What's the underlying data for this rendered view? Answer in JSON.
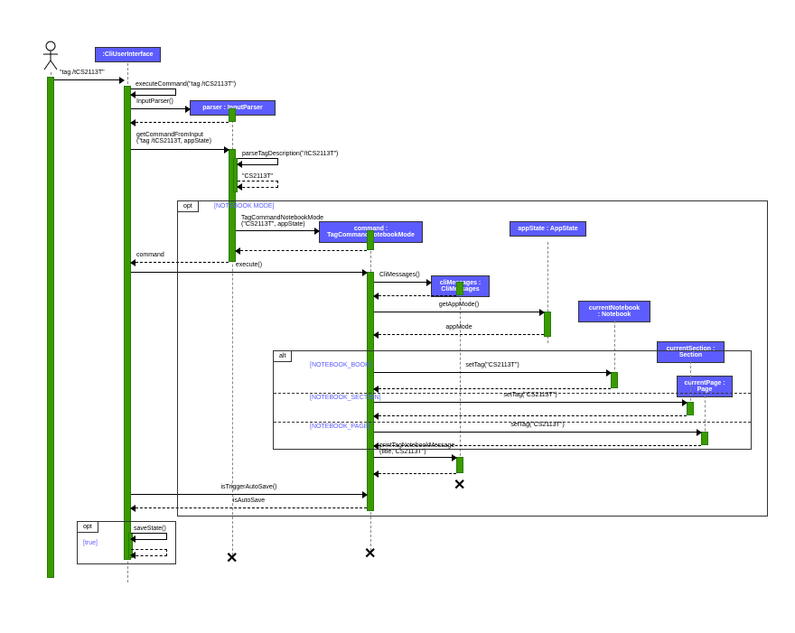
{
  "diagram_type": "UML Sequence Diagram",
  "actor": "user",
  "participants": [
    {
      "id": "cli",
      "name": ":CliUserInterface"
    },
    {
      "id": "parser",
      "name": "parser : InputParser"
    },
    {
      "id": "command",
      "name": "command :\nTagCommandNotebookMode"
    },
    {
      "id": "cliMessages",
      "name": "cliMessages :\nCliMessages"
    },
    {
      "id": "appState",
      "name": "appState : AppState"
    },
    {
      "id": "currentNotebook",
      "name": "currentNotebook\n: Notebook"
    },
    {
      "id": "currentSection",
      "name": "currentSection :\nSection"
    },
    {
      "id": "currentPage",
      "name": "currentPage :\nPage"
    }
  ],
  "messages": {
    "m1": "\"tag /tCS2113T\"",
    "m2": "executeCommand(\"tag /tCS2113T\")",
    "m3": "InputParser()",
    "m4": "getCommandFromInput\n(\"tag /tCS2113T, appState)",
    "m5": "parseTagDescription(\"/tCS2113T\")",
    "m6": "\"CS2113T\"",
    "m7": "TagCommandNotebookMode\n(\"CS2113T\", appState)",
    "m8": "command",
    "m9": "execute()",
    "m10": "CliMessages()",
    "m11": "getAppMode()",
    "m12": "appMode",
    "m13": "setTag(\"CS2113T\")",
    "m14": "setTag(\"CS2113T\")",
    "m15": "setTag(\"CS2113T\")",
    "m16": "printTagNotebookMessage\n(title,\"CS2113T\")",
    "m17": "isTriggerAutoSave()",
    "m18": "isAutoSave",
    "m19": "saveState()"
  },
  "frames": {
    "opt1": {
      "type": "opt",
      "guard": "[NOTEBOOK MODE]"
    },
    "alt": {
      "type": "alt",
      "guard1": "[NOTEBOOK_BOOK]",
      "guard2": "[NOTEBOOK_SECTION]",
      "guard3": "[NOTEBOOK_PAGE]"
    },
    "opt2": {
      "type": "opt",
      "guard": "[true]"
    }
  },
  "colors": {
    "participant": "#5c5cff",
    "activation": "#3a9b00"
  }
}
